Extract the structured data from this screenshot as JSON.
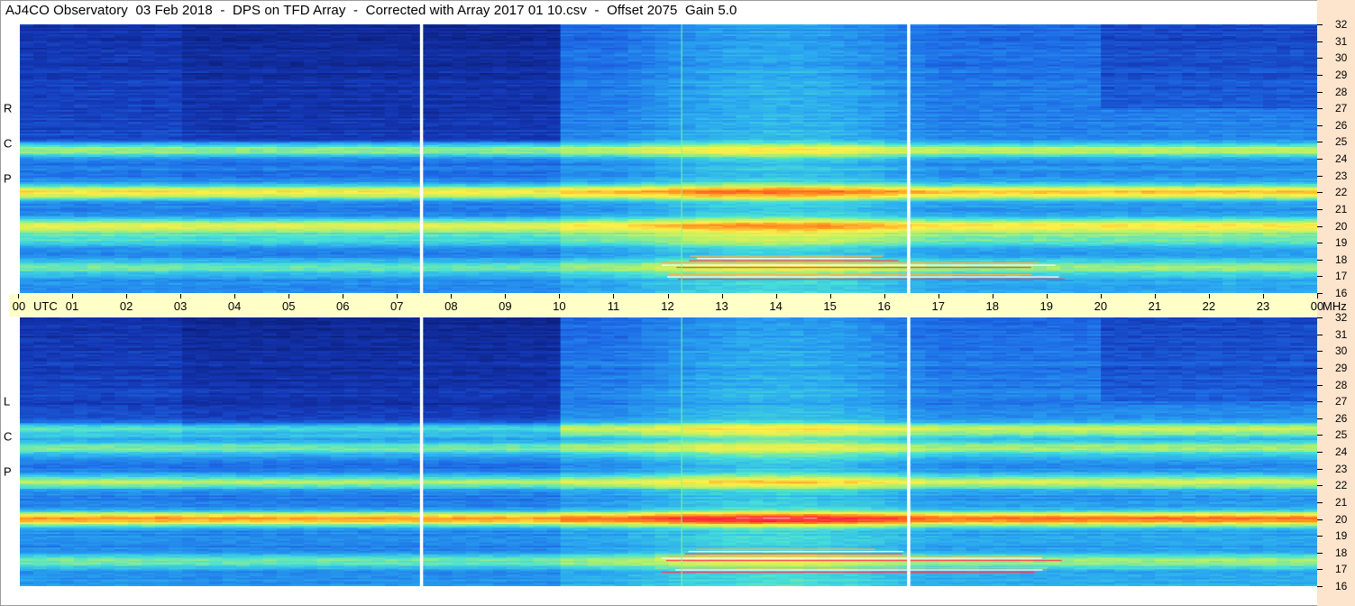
{
  "title": "AJ4CO Observatory  03 Feb 2018  -  DPS on TFD Array  -  Corrected with Array 2017 01 10.csv  -  Offset 2075  Gain 5.0",
  "colors": {
    "background": "#ffffff",
    "axis_strip": "#ffffc8",
    "right_strip": "#fde4cc",
    "colormap": [
      "#0a1a6e",
      "#1436b4",
      "#1e6be6",
      "#2aa8f0",
      "#46e0d8",
      "#b4f06a",
      "#fff048",
      "#ff8a1e",
      "#ff1e3c",
      "#ffffff"
    ]
  },
  "chart_data": {
    "type": "heatmap",
    "x_axis": {
      "unit_label": "UTC",
      "tick_labels": [
        "00",
        "01",
        "02",
        "03",
        "04",
        "05",
        "06",
        "07",
        "08",
        "09",
        "10",
        "11",
        "12",
        "13",
        "14",
        "15",
        "16",
        "17",
        "18",
        "19",
        "20",
        "21",
        "22",
        "23",
        "00"
      ],
      "range_hours": [
        0,
        24
      ]
    },
    "y_axis": {
      "unit_label": "MHz",
      "tick_labels": [
        "32",
        "31",
        "30",
        "29",
        "28",
        "27",
        "26",
        "25",
        "24",
        "23",
        "22",
        "21",
        "20",
        "19",
        "18",
        "17",
        "16"
      ],
      "range_mhz": [
        16,
        32
      ]
    },
    "panels": [
      {
        "polarization_letters": [
          "R",
          "C",
          "P"
        ],
        "bright_bands_mhz": [
          {
            "f": 22.0,
            "level": 0.62
          },
          {
            "f": 20.0,
            "level": 0.58
          },
          {
            "f": 24.5,
            "level": 0.5
          },
          {
            "f": 17.5,
            "level": 0.4
          },
          {
            "f": 19.2,
            "level": 0.38
          }
        ]
      },
      {
        "polarization_letters": [
          "L",
          "C",
          "P"
        ],
        "bright_bands_mhz": [
          {
            "f": 20.0,
            "level": 0.7
          },
          {
            "f": 22.2,
            "level": 0.5
          },
          {
            "f": 25.3,
            "level": 0.52
          },
          {
            "f": 24.2,
            "level": 0.48
          },
          {
            "f": 17.5,
            "level": 0.4
          }
        ]
      }
    ],
    "white_gaps_utc_hours": [
      7.45,
      16.45
    ],
    "green_vertical_line_utc_hours": [
      12.25
    ],
    "interference_bursts": [
      {
        "start_h": 11.8,
        "end_h": 19.5,
        "f_mhz": 17.0
      },
      {
        "start_h": 11.8,
        "end_h": 19.5,
        "f_mhz": 17.7
      },
      {
        "start_h": 12.2,
        "end_h": 16.5,
        "f_mhz": 18.1
      }
    ]
  }
}
